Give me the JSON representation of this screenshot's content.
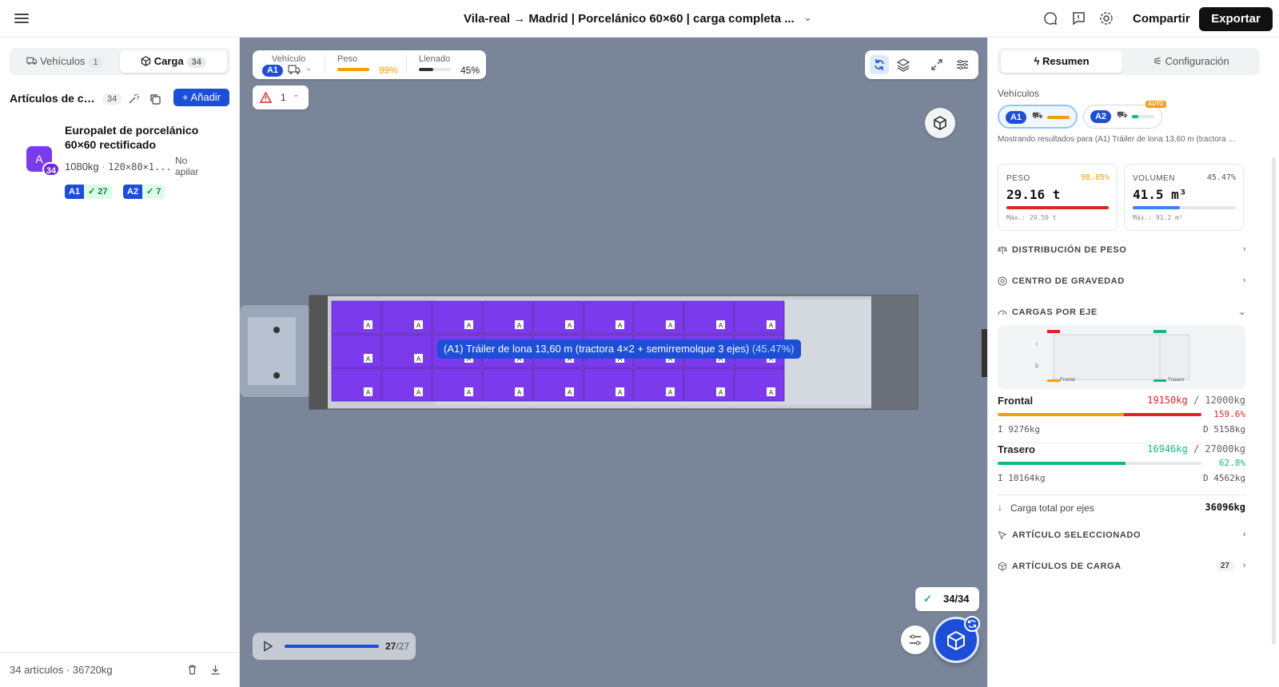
{
  "topbar": {
    "title": "Vila-real → Madrid | Porcelánico 60×60 | carga completa ...",
    "share_label": "Compartir",
    "export_label": "Exportar"
  },
  "left_panel": {
    "tabs": [
      {
        "label": "Vehículos",
        "count": "1"
      },
      {
        "label": "Carga",
        "count": "34"
      }
    ],
    "list_title": "Artículos de ca...",
    "list_count": "34",
    "add_label": "+ Añadir",
    "item": {
      "avatar_letter": "A",
      "avatar_count": "34",
      "name": "Europalet de porcelánico 60×60 rectificado",
      "weight": "1080kg",
      "dims": "120×80×1...",
      "stacking": "No apilar",
      "vehicle_tags": [
        {
          "vehicle": "A1",
          "count": "✓ 27"
        },
        {
          "vehicle": "A2",
          "count": "✓ 7"
        }
      ]
    },
    "footer": "34 artículos · 36720kg"
  },
  "viewport": {
    "stats": {
      "vehicle_label": "Vehículo",
      "vehicle_id": "A1",
      "weight_label": "Peso",
      "weight_pct": "99%",
      "weight_fill": 0.99,
      "fill_label": "Llenado",
      "fill_pct": "45%",
      "fill_fill": 0.45
    },
    "warnings_count": "1",
    "tooltip_text": "(A1) Tráiler de lona 13,60 m (tractora 4×2 + semirremolque 3 ejes)",
    "tooltip_pct": "(45.47%)",
    "placed": "34/34",
    "player_current": "27",
    "player_total": "/27",
    "pallet_label": "A",
    "accent": "#7c3aed"
  },
  "right_panel": {
    "tabs": [
      "Resumen",
      "Configuración"
    ],
    "vehicles_label": "Vehículos",
    "vehicles": [
      {
        "id": "A1",
        "selected": true
      },
      {
        "id": "A2",
        "badge": "AUTO"
      }
    ],
    "showing": "Mostrando resultados para (A1) Tráiler de lona 13,60 m (tractora ...",
    "weight": {
      "label": "PESO",
      "pct": "98.85%",
      "value": "29.16 t",
      "max": "Máx.: 29.50 t",
      "fill": 0.9885
    },
    "volume": {
      "label": "VOLUMEN",
      "pct": "45.47%",
      "value": "41.5 m³",
      "max": "Máx.: 91.2 m³",
      "fill": 0.4547
    },
    "sections": {
      "weight_dist": "DISTRIBUCIÓN DE PESO",
      "cog": "CENTRO DE GRAVEDAD",
      "axle_loads": "CARGAS POR EJE",
      "selected_item": "ARTÍCULO SELECCIONADO",
      "cargo_items": "ARTÍCULOS DE CARGA",
      "cargo_items_count": "27"
    },
    "axle_chart": {
      "y_labels": [
        "I",
        "D"
      ],
      "x_labels": [
        "Frontal",
        "Trasero"
      ]
    },
    "axles": [
      {
        "name": "Frontal",
        "load": "19150kg",
        "limit": "/ 12000kg",
        "pct": "159.6%",
        "left": "I 9276kg",
        "right": "D 5158kg",
        "fill": 1.0
      },
      {
        "name": "Trasero",
        "load": "16946kg",
        "limit": "/ 27000kg",
        "pct": "62.8%",
        "left": "I 10164kg",
        "right": "D 4562kg",
        "fill": 0.628
      }
    ],
    "total_label": "Carga total por ejes",
    "total_value": "36096kg"
  },
  "colors": {
    "primary": "#1d4ed8",
    "danger": "#dc2626",
    "success": "#10b981",
    "warning": "#f59e0b",
    "cargo": "#7c3aed"
  }
}
